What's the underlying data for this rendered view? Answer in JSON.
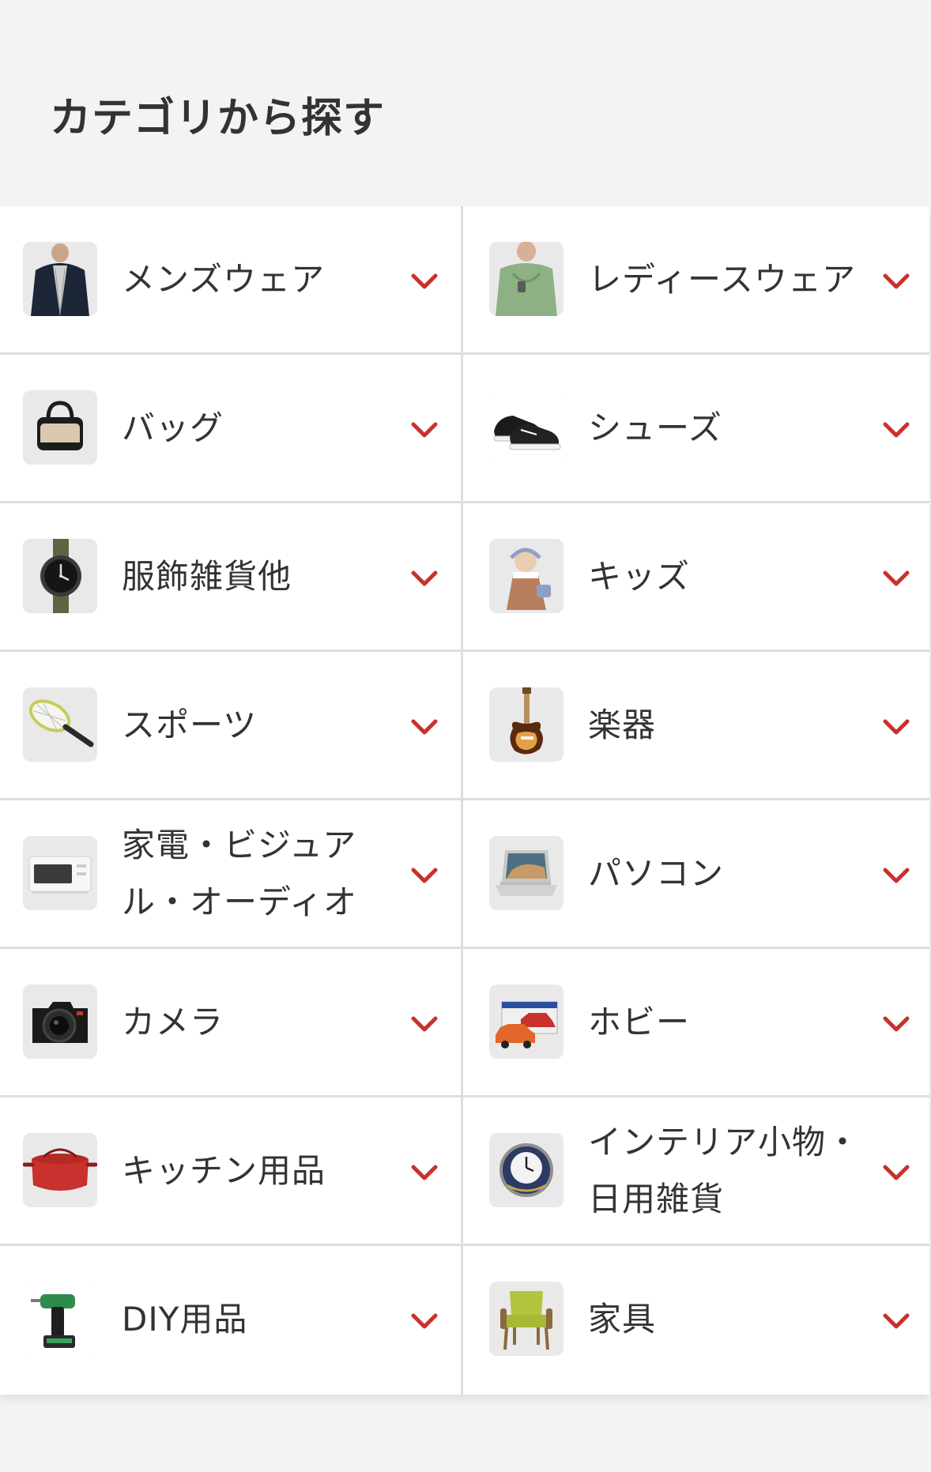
{
  "header": {
    "title": "カテゴリから探す"
  },
  "categories": [
    {
      "label": "メンズウェア",
      "icon": "mens-jacket-icon"
    },
    {
      "label": "レディースウェア",
      "icon": "womens-jacket-icon"
    },
    {
      "label": "バッグ",
      "icon": "bag-icon"
    },
    {
      "label": "シューズ",
      "icon": "sneakers-icon"
    },
    {
      "label": "服飾雑貨他",
      "icon": "wristwatch-icon"
    },
    {
      "label": "キッズ",
      "icon": "kids-doll-icon"
    },
    {
      "label": "スポーツ",
      "icon": "tennis-racket-icon"
    },
    {
      "label": "楽器",
      "icon": "electric-guitar-icon"
    },
    {
      "label": "家電・ビジュアル・オーディオ",
      "icon": "toaster-oven-icon"
    },
    {
      "label": "パソコン",
      "icon": "laptop-icon"
    },
    {
      "label": "カメラ",
      "icon": "camera-icon"
    },
    {
      "label": "ホビー",
      "icon": "toy-car-icon"
    },
    {
      "label": "キッチン用品",
      "icon": "cooking-pot-icon"
    },
    {
      "label": "インテリア小物・日用雑貨",
      "icon": "wall-clock-icon"
    },
    {
      "label": "DIY用品",
      "icon": "power-drill-icon"
    },
    {
      "label": "家具",
      "icon": "armchair-icon"
    }
  ],
  "colors": {
    "accent": "#c8312d",
    "text": "#333333",
    "background": "#f3f3f4",
    "card": "#ffffff",
    "divider": "#dddddd"
  }
}
